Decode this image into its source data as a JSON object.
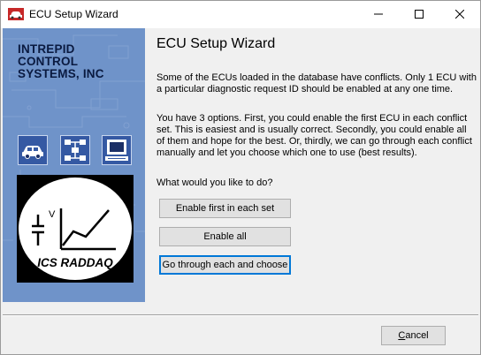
{
  "window": {
    "title": "ECU Setup Wizard",
    "app_icon": "car-icon",
    "controls": {
      "minimize": "minimize-icon",
      "maximize": "maximize-icon",
      "close": "close-icon"
    }
  },
  "banner": {
    "company_lines": [
      "INTREPID",
      "CONTROL",
      "SYSTEMS, INC"
    ],
    "tiles": [
      "car-icon",
      "network-icon",
      "computer-icon"
    ],
    "logo_caption": "ICS RADDAQ",
    "logo_v": "V",
    "colors": {
      "background": "#6f93c9",
      "tile": "#3559a3"
    }
  },
  "content": {
    "heading": "ECU Setup Wizard",
    "paragraph1": "Some of the ECUs loaded in the database have conflicts. Only 1 ECU with a particular diagnostic request ID should be enabled at any one time.",
    "paragraph2": "You have 3 options. First, you could enable the first ECU in each conflict set. This is easiest and is usually correct. Secondly, you could enable all of them and hope for the best. Or, thirdly, we can go through each conflict manually and let you choose which one to use (best results).",
    "question": "What would you like to do?",
    "buttons": {
      "enable_first": "Enable first in each set",
      "enable_all": "Enable all",
      "go_through": "Go through each and choose"
    }
  },
  "footer": {
    "cancel_first": "C",
    "cancel_rest": "ancel"
  },
  "colors": {
    "focus_border": "#0078d7",
    "button_face": "#e1e1e1"
  }
}
